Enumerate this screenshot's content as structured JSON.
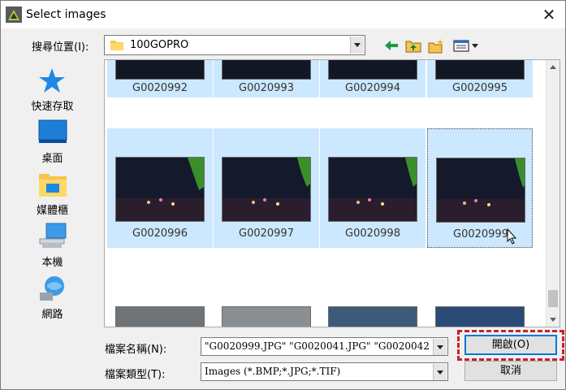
{
  "window": {
    "title": "Select images",
    "close_glyph": "✕"
  },
  "toolbar": {
    "lookin_label": "搜尋位置(I):",
    "lookin_value": "100GOPRO",
    "icons": [
      "back-arrow-icon",
      "up-folder-icon",
      "new-folder-icon",
      "view-menu-icon"
    ]
  },
  "places": [
    {
      "label": "快速存取",
      "icon": "quick-access-star-icon"
    },
    {
      "label": "桌面",
      "icon": "desktop-icon"
    },
    {
      "label": "媒體櫃",
      "icon": "libraries-icon"
    },
    {
      "label": "本機",
      "icon": "this-pc-icon"
    },
    {
      "label": "網路",
      "icon": "network-icon"
    }
  ],
  "files": {
    "row1": [
      "G0020992",
      "G0020993",
      "G0020994",
      "G0020995"
    ],
    "row2": [
      "G0020996",
      "G0020997",
      "G0020998",
      "G0020999"
    ],
    "row3": [
      "",
      "",
      "",
      ""
    ]
  },
  "filename": {
    "label": "檔案名稱(N):",
    "value": "\"G0020999.JPG\" \"G0020041.JPG\" \"G0020042"
  },
  "filetype": {
    "label": "檔案類型(T):",
    "value": "Images (*.BMP;*.JPG;*.TIF)"
  },
  "buttons": {
    "open": "開啟(O)",
    "cancel": "取消"
  },
  "colors": {
    "selection": "#cce8ff",
    "highlight": "#d11f28",
    "focus": "#0078d7"
  }
}
